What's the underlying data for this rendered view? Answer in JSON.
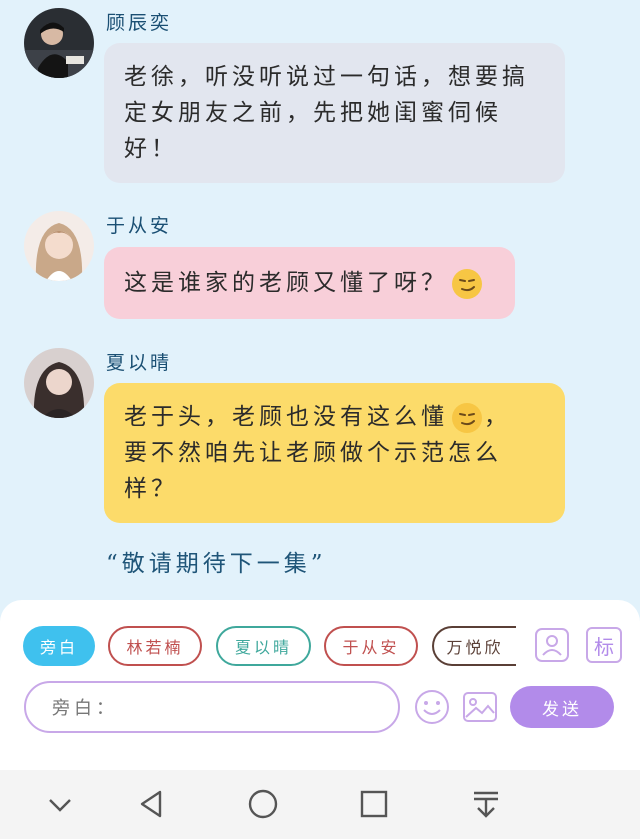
{
  "messages": [
    {
      "name": "顾辰奕",
      "lines": [
        "老徐，听没听说过一句话，想要搞",
        "定女朋友之前，先把她闺蜜伺候",
        "好！"
      ],
      "bubble_color": "#e2e6ef"
    },
    {
      "name": "于从安",
      "lines": [
        "这是谁家的老顾又懂了呀？"
      ],
      "bubble_color": "#f8cfd9",
      "emoji": "smirk-emoji"
    },
    {
      "name": "夏以晴",
      "lines": [
        "老于头，老顾也没有这么懂",
        "要不然咱先让老顾做个示范怎么",
        "样？"
      ],
      "line1_suffix": "，",
      "bubble_color": "#fcdb6a",
      "emoji": "smirk-emoji"
    }
  ],
  "to_be_continued": "“敬请期待下一集”",
  "roles": [
    {
      "label": "旁白",
      "color": "#3fc1ee",
      "active": true
    },
    {
      "label": "林若楠",
      "color": "#c0504f",
      "active": false
    },
    {
      "label": "夏以晴",
      "color": "#3fa89c",
      "active": false
    },
    {
      "label": "于从安",
      "color": "#c0504f",
      "active": false
    },
    {
      "label": "万悦欣",
      "color": "#5a3f36",
      "active": false
    }
  ],
  "tools": {
    "contact_icon": "contact-card-icon",
    "tag_label": "标",
    "emoji_icon": "smiley-icon",
    "image_icon": "image-icon"
  },
  "input": {
    "placeholder": "旁白："
  },
  "send_label": "发送",
  "navbar": [
    "collapse-icon",
    "back-icon",
    "home-icon",
    "recents-icon",
    "download-icon"
  ],
  "colors": {
    "background": "#e2f2fb",
    "accent": "#b28bea"
  }
}
